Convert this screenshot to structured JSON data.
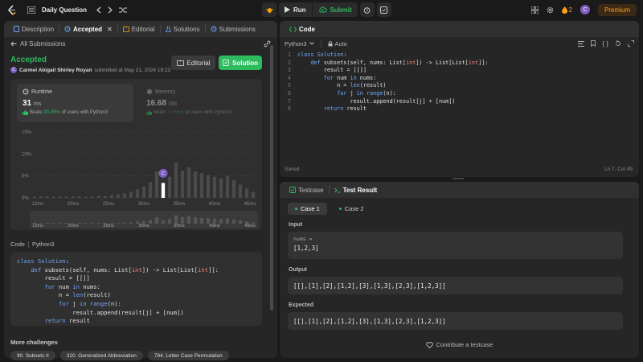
{
  "topbar": {
    "title": "Daily Question",
    "run_label": "Run",
    "submit_label": "Submit",
    "streak": "2",
    "avatar_letter": "C",
    "premium_label": "Premium"
  },
  "left_tabs": [
    {
      "label": "Description"
    },
    {
      "label": "Accepted"
    },
    {
      "label": "Editorial"
    },
    {
      "label": "Solutions"
    },
    {
      "label": "Submissions"
    }
  ],
  "submission": {
    "back_label": "All Submissions",
    "status": "Accepted",
    "user": "Carmel Abigail Shirley Royan",
    "submitted_text": "submitted at May 21, 2024 19:23",
    "editorial_btn": "Editorial",
    "solution_btn": "Solution",
    "avatar_letter": "C"
  },
  "runtime": {
    "label": "Runtime",
    "value": "31",
    "unit": "ms",
    "beats_prefix": "Beats",
    "beats_pct": "90.49%",
    "beats_suffix": "of users with Python3"
  },
  "memory": {
    "label": "Memory",
    "value": "16.68",
    "unit": "MB",
    "beats_prefix": "Beats",
    "beats_pct": "77.55%",
    "beats_suffix": "of users with Python3"
  },
  "chart_data": {
    "type": "bar",
    "y_ticks": [
      "15%",
      "10%",
      "5%",
      "0%"
    ],
    "x_ticks": [
      "12ms",
      "20ms",
      "25ms",
      "30ms",
      "35ms",
      "40ms",
      "45ms"
    ],
    "mini_x_ticks": [
      "12ms",
      "20ms",
      "25ms",
      "30ms",
      "35ms",
      "43ms",
      "45ms"
    ],
    "marker_letter": "C",
    "highlight_ms": 31,
    "values": [
      0.3,
      0.3,
      0.3,
      0.3,
      0.3,
      0.3,
      0.3,
      0.3,
      0.3,
      0.3,
      0.4,
      0.4,
      0.6,
      0.8,
      1.0,
      1.4,
      2.0,
      2.6,
      3.6,
      6.0,
      3.4,
      4.8,
      8.0,
      6.2,
      7.0,
      6.0,
      5.6,
      5.2,
      4.8,
      4.4,
      5.0,
      4.0,
      3.0,
      2.2,
      1.4
    ],
    "ylim": [
      0,
      15
    ]
  },
  "code_section": {
    "label": "Code",
    "lang": "Python3",
    "lines": [
      "class Solution:",
      "    def subsets(self, nums: List[int]) -> List[List[int]]:",
      "        result = [[]]",
      "        for num in nums:",
      "            n = len(result)",
      "            for j in range(n):",
      "                result.append(result[j] + [num])",
      "        return result"
    ]
  },
  "more_challenges": {
    "label": "More challenges",
    "items": [
      "90. Subsets II",
      "320. Generalized Abbreviation",
      "784. Letter Case Permutation"
    ]
  },
  "editor": {
    "tab_label": "Code",
    "lang": "Python3",
    "mode": "Auto",
    "line_numbers": [
      "1",
      "2",
      "3",
      "4",
      "5",
      "6",
      "7",
      "8"
    ],
    "status_left": "Saved",
    "status_right": "Ln 7, Col 49"
  },
  "result": {
    "tab_testcase": "Testcase",
    "tab_result": "Test Result",
    "case1": "Case 1",
    "case2": "Case 2",
    "input_label": "Input",
    "input_var": "nums =",
    "input_value": "[1,2,3]",
    "output_label": "Output",
    "output_value": "[[],[1],[2],[1,2],[3],[1,3],[2,3],[1,2,3]]",
    "expected_label": "Expected",
    "expected_value": "[[],[1],[2],[1,2],[3],[1,3],[2,3],[1,2,3]]",
    "contribute": "Contribute a testcase"
  },
  "colors": {
    "accent_green": "#2cbb5d",
    "premium_orange": "#ffa116",
    "avatar_purple": "#7c5cbf"
  }
}
